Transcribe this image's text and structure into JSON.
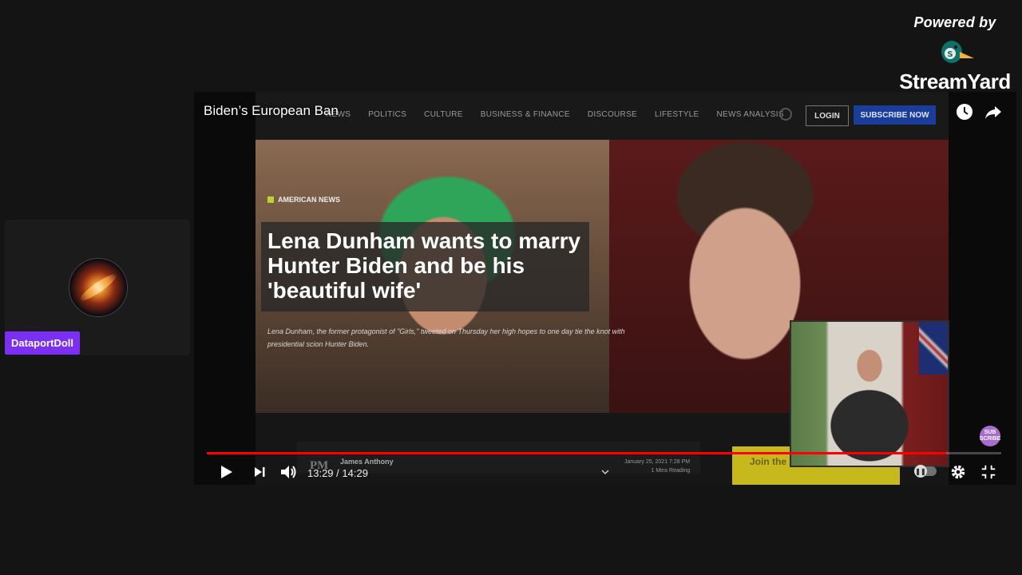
{
  "branding": {
    "powered_by": "Powered by",
    "brand_name": "StreamYard",
    "icon": "duck-logo-icon"
  },
  "participant": {
    "name": "DataportDoll",
    "tag_color": "#7b2ff2"
  },
  "player": {
    "video_title": "Biden’s European Ban",
    "current_time": "13:29",
    "separator": " / ",
    "duration": "14:29",
    "progress": 0.931,
    "accent_color": "#ff0000",
    "icons": [
      "watch-later-icon",
      "share-icon",
      "play-icon",
      "next-icon",
      "volume-icon",
      "settings-icon",
      "exit-fullscreen-icon"
    ]
  },
  "article": {
    "nav": [
      "NEWS",
      "POLITICS",
      "CULTURE",
      "BUSINESS & FINANCE",
      "DISCOURSE",
      "LIFESTYLE",
      "NEWS ANALYSIS"
    ],
    "login": "LOGIN",
    "subscribe": "SUBSCRIBE NOW",
    "category": "AMERICAN NEWS",
    "headline": "Lena Dunham wants to marry Hunter Biden and be his 'beautiful wife'",
    "subtext": "Lena Dunham, the former protagonist of \"Girls,\" tweeted on Thursday her high hopes to one day tie the knot with presidential scion Hunter Biden.",
    "logo": "PM",
    "author": "James Anthony",
    "date": "January 25, 2021 7:28 PM",
    "read_time": "1 Mins Reading",
    "join": "Join the"
  },
  "overlay": {
    "sub_badge": "SUB SCRIBE"
  }
}
